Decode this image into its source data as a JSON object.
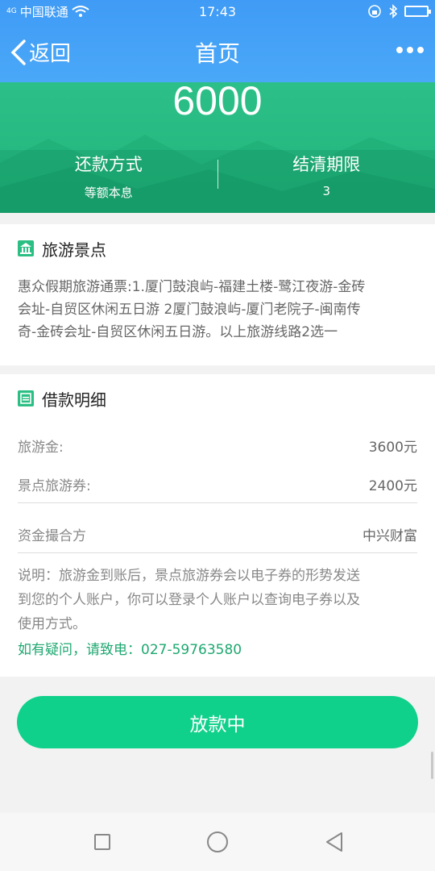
{
  "status": {
    "carrier": "中国联通",
    "signal_label": "4G",
    "time": "17:43"
  },
  "nav": {
    "back_label": "返回",
    "title": "首页"
  },
  "hero": {
    "amount": "6000",
    "left_key": "还款方式",
    "left_value": "等额本息",
    "right_key": "结清期限",
    "right_value": "3"
  },
  "attractions": {
    "title": "旅游景点",
    "lines": [
      "惠众假期旅游通票:1.厦门鼓浪屿-福建土楼-鹭江夜游-金砖",
      "会址-自贸区休闲五日游 2厦门鼓浪屿-厦门老院子-闽南传",
      "奇-金砖会址-自贸区休闲五日游。以上旅游线路2选一"
    ]
  },
  "loan": {
    "title": "借款明细",
    "rows": [
      {
        "label": "旅游金:",
        "value": "3600元"
      },
      {
        "label": "景点旅游券:",
        "value": "2400元"
      },
      {
        "label": "资金撮合方",
        "value": "中兴财富"
      }
    ],
    "note_lines": [
      "说明：旅游金到账后，景点旅游券会以电子券的形势发送",
      "到您的个人账户，你可以登录个人账户以查询电子券以及",
      "使用方式。"
    ],
    "phone": "如有疑问，请致电：027-59763580"
  },
  "button": {
    "label": "放款中"
  },
  "colors": {
    "nav_blue": "#3f9bf5",
    "hero_green": "#21b57c",
    "button_green": "#10d18b",
    "phone_green": "#1ea870"
  },
  "icons": [
    "back-chevron-icon",
    "more-dots-icon",
    "landmark-icon",
    "document-icon",
    "recent-apps-icon",
    "home-circle-icon",
    "back-triangle-icon"
  ]
}
